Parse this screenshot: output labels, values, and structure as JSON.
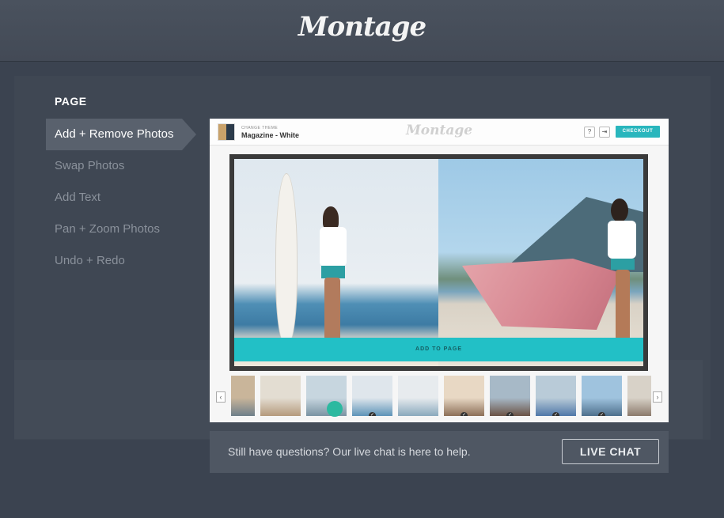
{
  "app": {
    "logo_text": "Montage"
  },
  "tutorial": {
    "heading": "PAGE",
    "items": [
      {
        "label": "Add + Remove Photos",
        "active": true
      },
      {
        "label": "Swap Photos",
        "active": false
      },
      {
        "label": "Add Text",
        "active": false
      },
      {
        "label": "Pan + Zoom Photos",
        "active": false
      },
      {
        "label": "Undo + Redo",
        "active": false
      }
    ]
  },
  "screen": {
    "theme_caption": "CHANGE THEME",
    "theme_name": "Magazine - White",
    "logo_text": "Montage",
    "help_icon": "?",
    "share_icon": "share-icon",
    "checkout_label": "CHECKOUT",
    "add_to_page_label": "ADD TO PAGE",
    "prev_icon": "chevron-left-icon",
    "next_icon": "chevron-right-icon",
    "prev_glyph": "‹",
    "next_glyph": "›",
    "thumbnails": [
      {
        "colors": [
          "#c9b59a",
          "#6e7f8a"
        ],
        "checked": false
      },
      {
        "colors": [
          "#e3ddd2",
          "#b59a7c"
        ],
        "checked": false
      },
      {
        "colors": [
          "#c7d6df",
          "#7a93a3"
        ],
        "checked": false
      },
      {
        "colors": [
          "#dfe6ec",
          "#5d93b8"
        ],
        "checked": true
      },
      {
        "colors": [
          "#e7ebee",
          "#8aa9bd"
        ],
        "checked": false
      },
      {
        "colors": [
          "#e8d8c4",
          "#8c6f58"
        ],
        "checked": true
      },
      {
        "colors": [
          "#a7b9c7",
          "#6b5346"
        ],
        "checked": true
      },
      {
        "colors": [
          "#b9cbd8",
          "#4f77a8"
        ],
        "checked": true
      },
      {
        "colors": [
          "#9fc3de",
          "#4d6f8c"
        ],
        "checked": true
      },
      {
        "colors": [
          "#d8d2c8",
          "#8b7a6c"
        ],
        "checked": false
      }
    ]
  },
  "help": {
    "text": "Still have questions? Our live chat is here to help.",
    "button_label": "LIVE CHAT"
  },
  "colors": {
    "accent": "#29b6bd",
    "background": "#3b4350"
  }
}
